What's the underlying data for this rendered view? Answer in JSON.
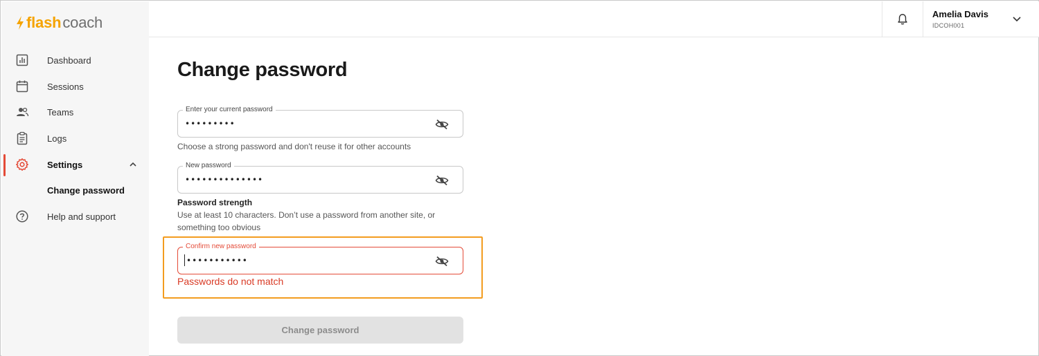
{
  "brand": {
    "name_part1": "flash",
    "name_part2": "coach",
    "accent_color": "#f5a300"
  },
  "sidebar": {
    "items": [
      {
        "label": "Dashboard",
        "icon": "dashboard-chart-icon"
      },
      {
        "label": "Sessions",
        "icon": "calendar-icon"
      },
      {
        "label": "Teams",
        "icon": "people-icon"
      },
      {
        "label": "Logs",
        "icon": "clipboard-icon"
      },
      {
        "label": "Settings",
        "icon": "gear-icon",
        "active": true,
        "expanded": true
      },
      {
        "label": "Help and support",
        "icon": "help-circle-icon"
      }
    ],
    "settings_subitems": [
      {
        "label": "Change password",
        "active": true
      }
    ],
    "active_color": "#e44a37"
  },
  "header": {
    "notification_icon": "bell-icon",
    "user": {
      "name": "Amelia Davis",
      "id": "IDCOH001"
    }
  },
  "main": {
    "title": "Change password",
    "current_password": {
      "label": "Enter your current password",
      "value": "•••••••••",
      "helper": "Choose a strong password and don't reuse it for other accounts"
    },
    "new_password": {
      "label": "New password",
      "value": "••••••••••••••"
    },
    "strength": {
      "title": "Password strength",
      "help": "Use at least 10 characters. Don’t use a password from another site, or something too obvious"
    },
    "confirm_password": {
      "label": "Confirm new password",
      "value": "•••••••••••",
      "error": "Passwords do not match"
    },
    "submit_label": "Change password",
    "error_color": "#d93a25",
    "highlight_color": "#f39c1f"
  }
}
